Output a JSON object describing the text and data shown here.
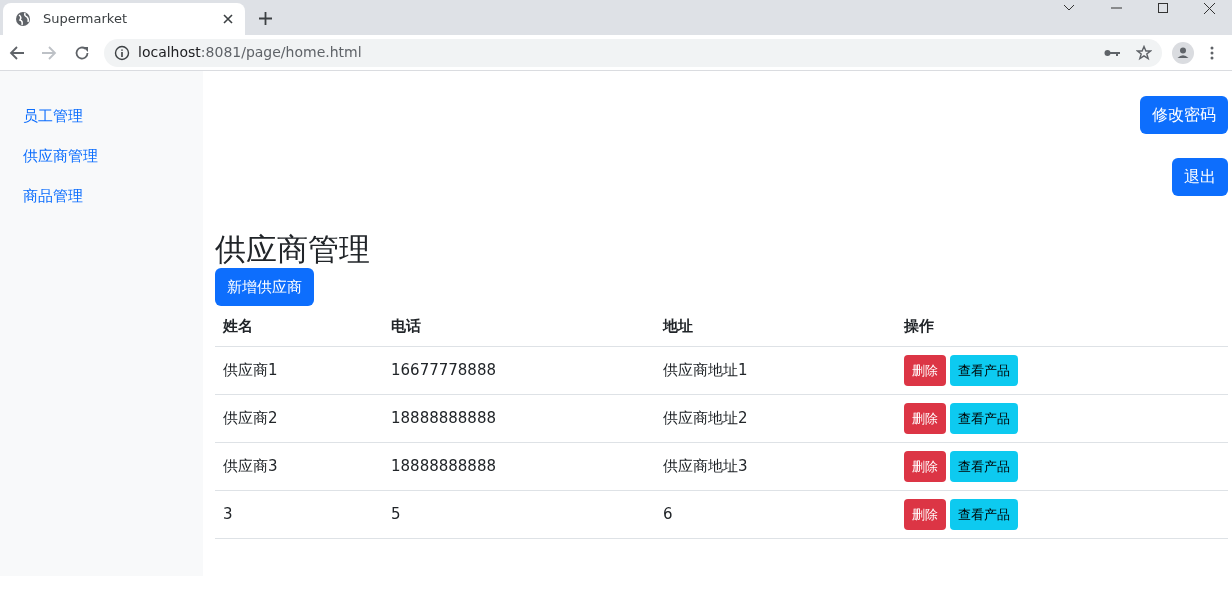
{
  "browser": {
    "tab_title": "Supermarket",
    "url_host": "localhost",
    "url_rest": ":8081/page/home.html"
  },
  "sidebar": {
    "items": [
      {
        "label": "员工管理"
      },
      {
        "label": "供应商管理"
      },
      {
        "label": "商品管理"
      }
    ]
  },
  "top_buttons": [
    "修改密码",
    "退出"
  ],
  "heading": "供应商管理",
  "add_button": "新增供应商",
  "table": {
    "columns": [
      "姓名",
      "电话",
      "地址",
      "操作"
    ],
    "rows": [
      {
        "cells": [
          "供应商1",
          "16677778888",
          "供应商地址1"
        ],
        "actions": [
          "删除",
          "查看产品"
        ]
      },
      {
        "cells": [
          "供应商2",
          "18888888888",
          "供应商地址2"
        ],
        "actions": [
          "删除",
          "查看产品"
        ]
      },
      {
        "cells": [
          "供应商3",
          "18888888888",
          "供应商地址3"
        ],
        "actions": [
          "删除",
          "查看产品"
        ]
      },
      {
        "cells": [
          "3",
          "5",
          "6"
        ],
        "actions": [
          "删除",
          "查看产品"
        ]
      }
    ]
  }
}
